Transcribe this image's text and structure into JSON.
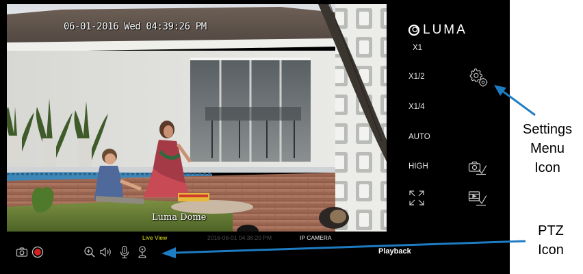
{
  "viewer": {
    "osd_timestamp": "06-01-2016 Wed 04:39:26 PM",
    "osd_caption": "Luma Dome"
  },
  "status": {
    "live_label": "Live View",
    "recording_time": "2016-06-01 04:38:20 PM",
    "camera_label": "IP CAMERA"
  },
  "toolbar": {
    "icons": [
      "camera-icon",
      "record-icon",
      "zoom-in-icon",
      "speaker-icon",
      "microphone-icon",
      "ptz-icon"
    ],
    "playback_label": "Playback"
  },
  "panel": {
    "logo_text": "LUMA",
    "stream_options": [
      "X1",
      "X1/2",
      "X1/4",
      "AUTO",
      "HIGH"
    ],
    "icons": [
      "settings-icon",
      "snapshot-download-icon",
      "fullscreen-icon",
      "video-download-icon"
    ]
  },
  "annotations": {
    "settings_line1": "Settings",
    "settings_line2": "Menu",
    "settings_line3": "Icon",
    "ptz_line1": "PTZ",
    "ptz_line2": "Icon"
  },
  "colors": {
    "live_label": "#e6e61a",
    "record_dot": "#d41f1f",
    "annotation_arrow": "#1e7cc2",
    "viewer_background": "#000000"
  }
}
